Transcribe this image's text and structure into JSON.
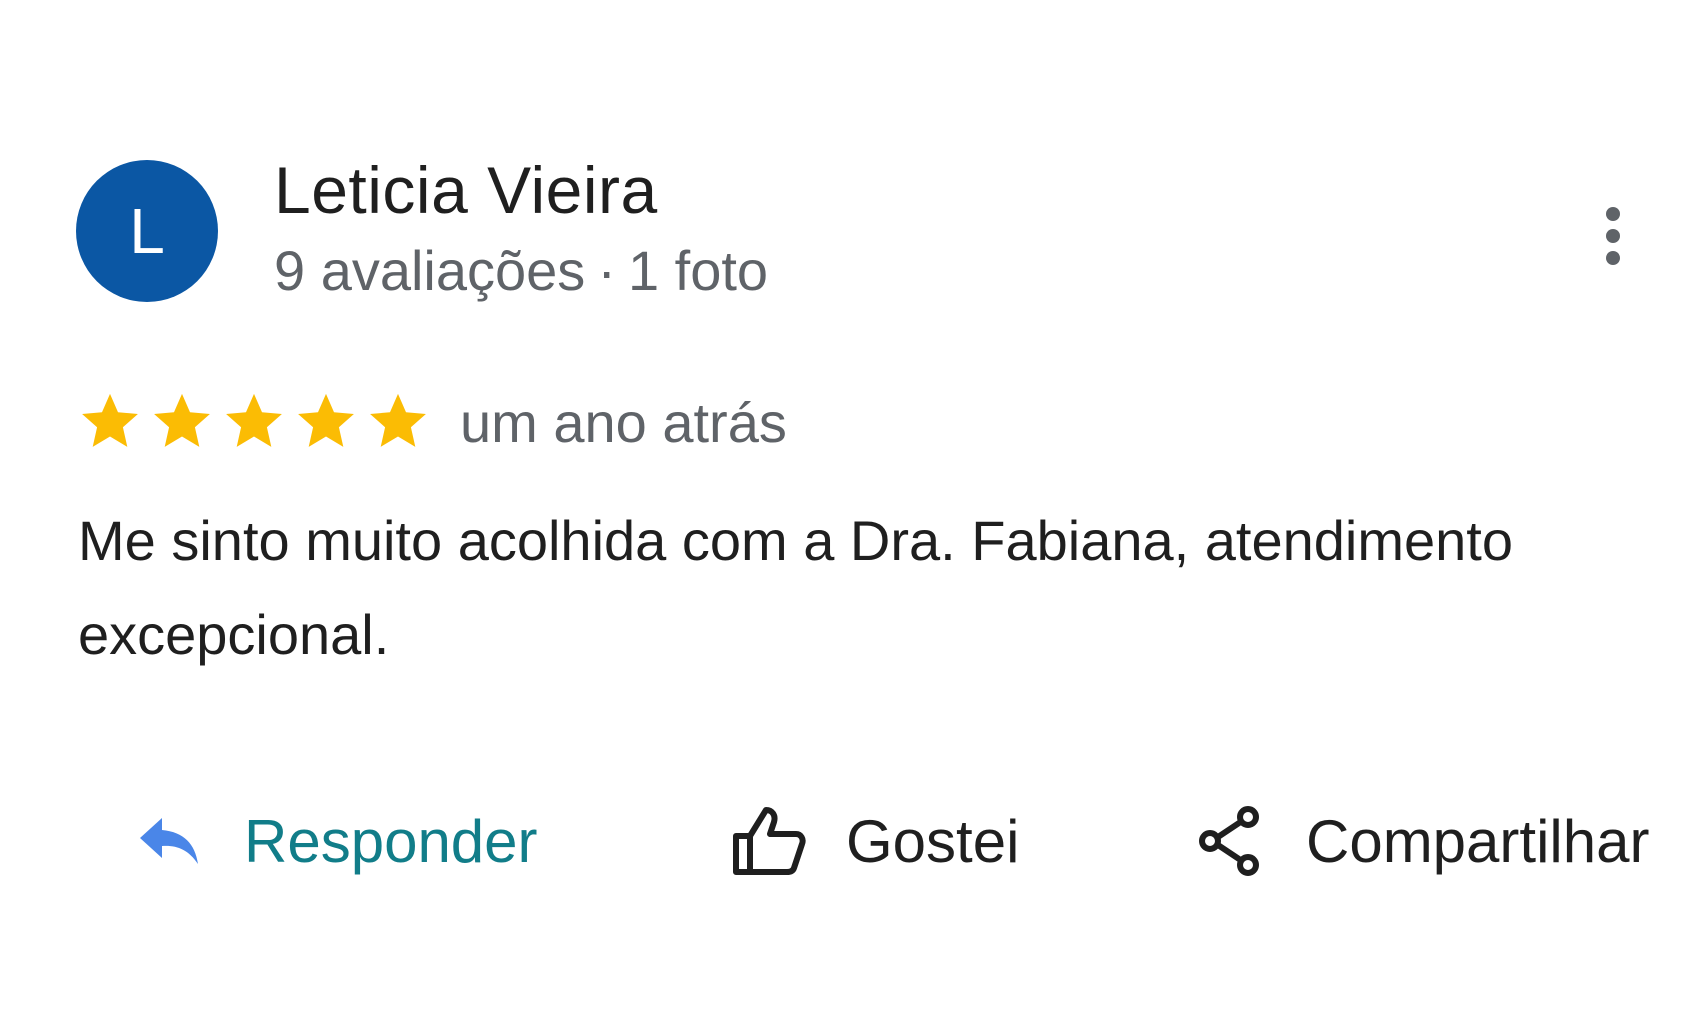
{
  "review": {
    "author": {
      "initial": "L",
      "name": "Leticia Vieira",
      "reviews_count": "9 avaliações",
      "separator": "·",
      "photos": "1 foto",
      "avatar_color": "#0b57a4"
    },
    "rating": 5,
    "rating_max": 5,
    "star_color": "#fbbc04",
    "time": "um ano atrás",
    "text": "Me sinto muito acolhida com a Dra. Fabiana, atendimento excepcional."
  },
  "actions": {
    "reply": {
      "label": "Responder",
      "icon": "reply-icon",
      "color": "#117d89"
    },
    "like": {
      "label": "Gostei",
      "icon": "thumb-up-icon"
    },
    "share": {
      "label": "Compartilhar",
      "icon": "share-icon"
    }
  },
  "menu": {
    "icon": "more-vert-icon"
  }
}
